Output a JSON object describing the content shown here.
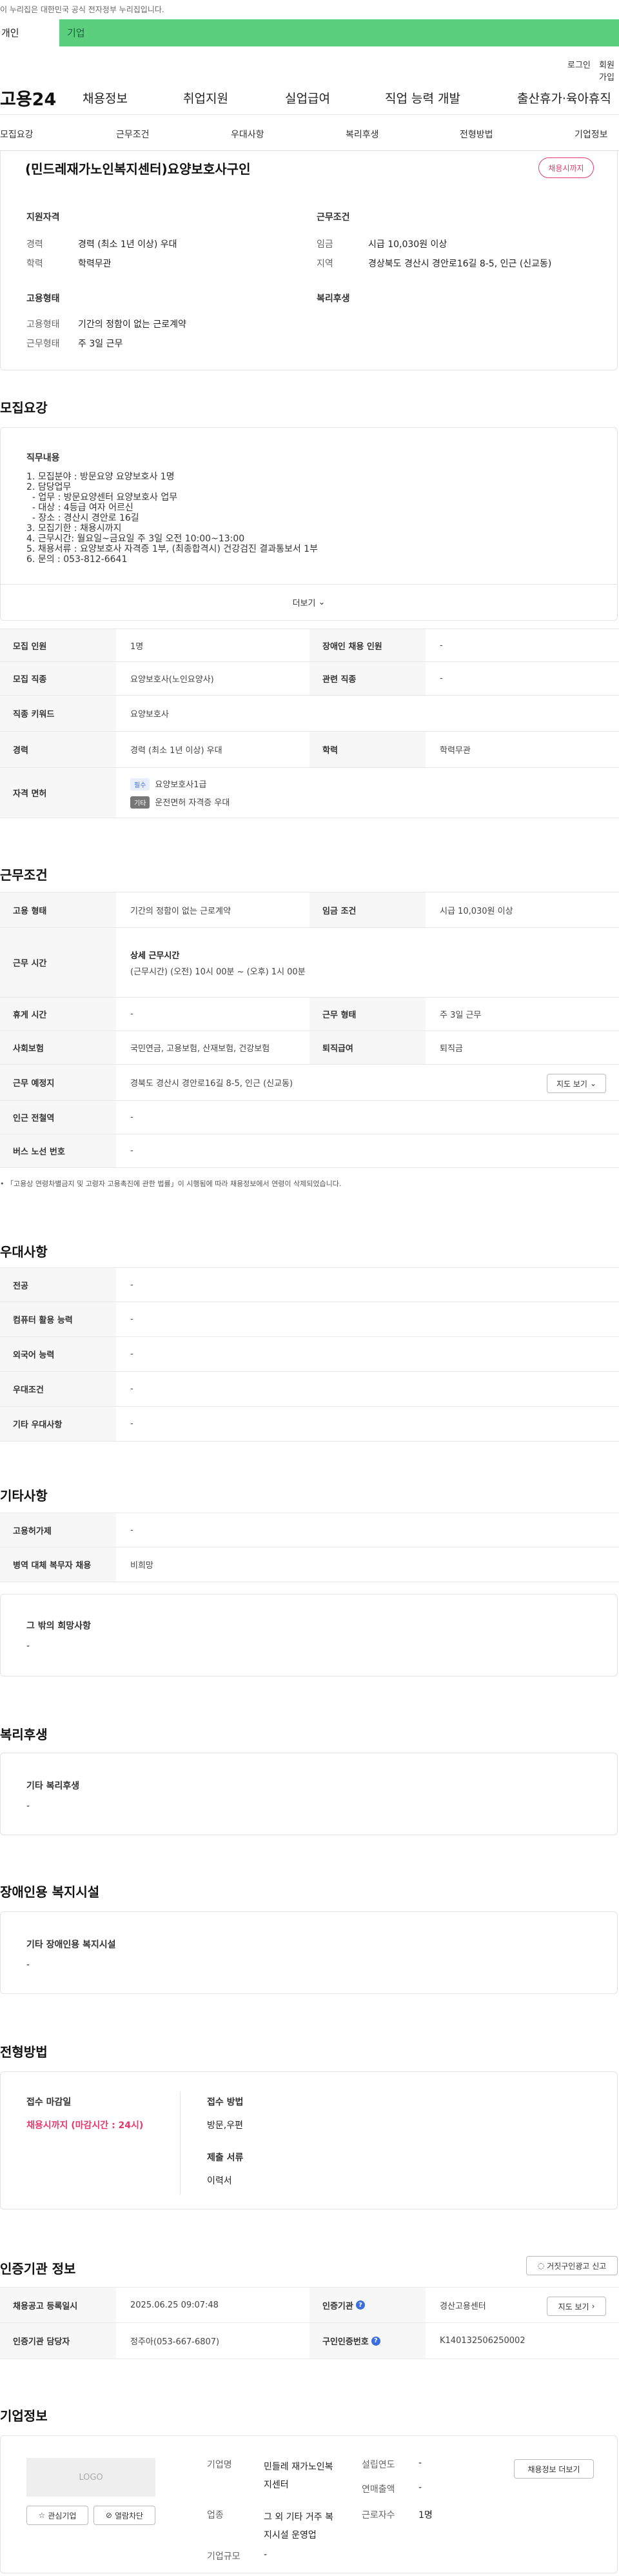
{
  "gov_notice": "이 누리집은 대한민국 공식 전자정부 누리집입니다.",
  "top_tabs": [
    "개인",
    "기업"
  ],
  "util": {
    "login": "로그인",
    "join": "회원가입"
  },
  "gnb": {
    "logo": "고용24",
    "menus": [
      "채용정보",
      "취업지원",
      "실업급여",
      "직업 능력 개발",
      "출산휴가·육아휴직"
    ]
  },
  "subnav": [
    "모집요강",
    "근무조건",
    "우대사항",
    "복리후생",
    "전형방법",
    "기업정보"
  ],
  "summary": {
    "title": "(민드레재가노인복지센터)요양보호사구인",
    "badge": "채용시까지",
    "qual_h": "지원자격",
    "career_l": "경력",
    "career_v": "경력 (최소 1년 이상) 우대",
    "edu_l": "학력",
    "edu_v": "학력무관",
    "cond_h": "근무조건",
    "wage_l": "임금",
    "wage_v": "시급 10,030원 이상",
    "area_l": "지역",
    "area_v": "경상북도 경산시 경안로16길 8-5, 인근 (신교동)",
    "emp_h": "고용형태",
    "emp_type_l": "고용형태",
    "emp_type_v": "기간의 정함이 없는 근로계약",
    "work_l": "근무형태",
    "work_v": "주 3일 근무",
    "welfare_h": "복리후생"
  },
  "recruit": {
    "title": "모집요강",
    "job_h": "직무내용",
    "lines": [
      "모집분야 : 방문요양 요양보호사 1명",
      "담당업무",
      "- 업무 : 방문요양센터 요양보호사 업무",
      "- 대상 : 4등급 여자 어르신",
      "- 장소 : 경산시 경안로 16길",
      "모집기한 : 채용시까지",
      "근무시간: 월요일~금요일 주 3일 오전 10:00~13:00",
      "채용서류 : 요양보호사 자격증 1부, (최종합격시) 건강검진 결과통보서 1부",
      "문의 : 053-812-6641"
    ],
    "more": "더보기",
    "t": {
      "count_l": "모집 인원",
      "count_v": "1명",
      "disabled_l": "장애인 채용 인원",
      "disabled_v": "-",
      "job_l": "모집 직종",
      "job_v": "요양보호사(노인요양사)",
      "rel_l": "관련 직종",
      "rel_v": "-",
      "code_l": "직종 키워드",
      "code_v": "요양보호사",
      "career_l": "경력",
      "career_v": "경력 (최소 1년 이상) 우대",
      "edu_l": "학력",
      "edu_v": "학력무관",
      "lic_l": "자격 면허",
      "lic1_tag": "필수",
      "lic1": "요양보호사1급",
      "lic2_tag": "기타",
      "lic2": "운전면허 자격증 우대"
    }
  },
  "work": {
    "title": "근무조건",
    "emp_l": "고용 형태",
    "emp_v": "기간의 정함이 없는 근로계약",
    "wage_l": "임금 조건",
    "wage_v": "시급 10,030원 이상",
    "time_l": "근무 시간",
    "time_h": "상세 근무시간",
    "time_v": "(근무시간) (오전) 10시 00분 ~ (오후) 1시 00분",
    "rest_l": "휴게 시간",
    "rest_v": "-",
    "shape_l": "근무 형태",
    "shape_v": "주 3일 근무",
    "ins_l": "사회보험",
    "ins_v": "국민연금, 고용보험, 산재보험, 건강보험",
    "ret_l": "퇴직급여",
    "ret_v": "퇴직금",
    "place_l": "근무 예정지",
    "place_v": "경북도 경산시 경안로16길 8-5, 인근 (신교동)",
    "map_btn": "지도 보기",
    "sub_l": "인근 전철역",
    "sub_v": "-",
    "bus_l": "버스 노선 번호",
    "bus_v": "-",
    "note": "「고용상 연령차별금지 및 고령자 고용촉진에 관한 법률」이 시행됨에 따라 채용정보에서 연령이 삭제되었습니다."
  },
  "pref": {
    "title": "우대사항",
    "rows": [
      [
        "전공",
        "-"
      ],
      [
        "컴퓨터 활용 능력",
        "-"
      ],
      [
        "외국어 능력",
        "-"
      ],
      [
        "우대조건",
        "-"
      ],
      [
        "기타 우대사항",
        "-"
      ]
    ]
  },
  "etc": {
    "title": "기타사항",
    "rows": [
      [
        "고용허가제",
        "-"
      ],
      [
        "병역 대체 복무자 채용",
        "비희망"
      ]
    ],
    "box_h": "그 밖의 희망사항",
    "box_v": "-"
  },
  "welfare": {
    "title": "복리후생",
    "box_h": "기타 복리후생",
    "box_v": "-"
  },
  "disab": {
    "title": "장애인용 복지시설",
    "box_h": "기타 장애인용 복지시설",
    "box_v": "-"
  },
  "screen": {
    "title": "전형방법",
    "deadline_h": "접수 마감일",
    "deadline_v": "채용시까지 (마감시간 : 24시)",
    "method_h": "접수 방법",
    "method_v": "방문,우편",
    "docs_h": "제출 서류",
    "docs_v": "이력서"
  },
  "agency": {
    "title": "인증기관 정보",
    "report_btn": "거짓구인광고 신고",
    "reg_l": "채용공고 등록일시",
    "reg_v": "2025.06.25 09:07:48",
    "org_l": "인증기관",
    "org_v": "경산고용센터",
    "map_btn": "지도 보기",
    "mgr_l": "인증기관 담당자",
    "mgr_v": "정주아(053-667-6807)",
    "num_l": "구인인증번호",
    "num_v": "K140132506250002"
  },
  "company": {
    "title": "기업정보",
    "logo": "LOGO",
    "fav_btn": "관심기업",
    "block_btn": "열람차단",
    "name_l": "기업명",
    "name_v": "민들레 재가노인복지센터",
    "found_l": "설립연도",
    "found_v": "-",
    "sales_l": "연매출액",
    "sales_v": "-",
    "ind_l": "업종",
    "ind_v": "그 외 기타 거주 복지시설 운영업",
    "staff_l": "근로자수",
    "staff_v": "1명",
    "scale_l": "기업규모",
    "scale_v": "-",
    "more_btn": "채용정보 더보기"
  }
}
